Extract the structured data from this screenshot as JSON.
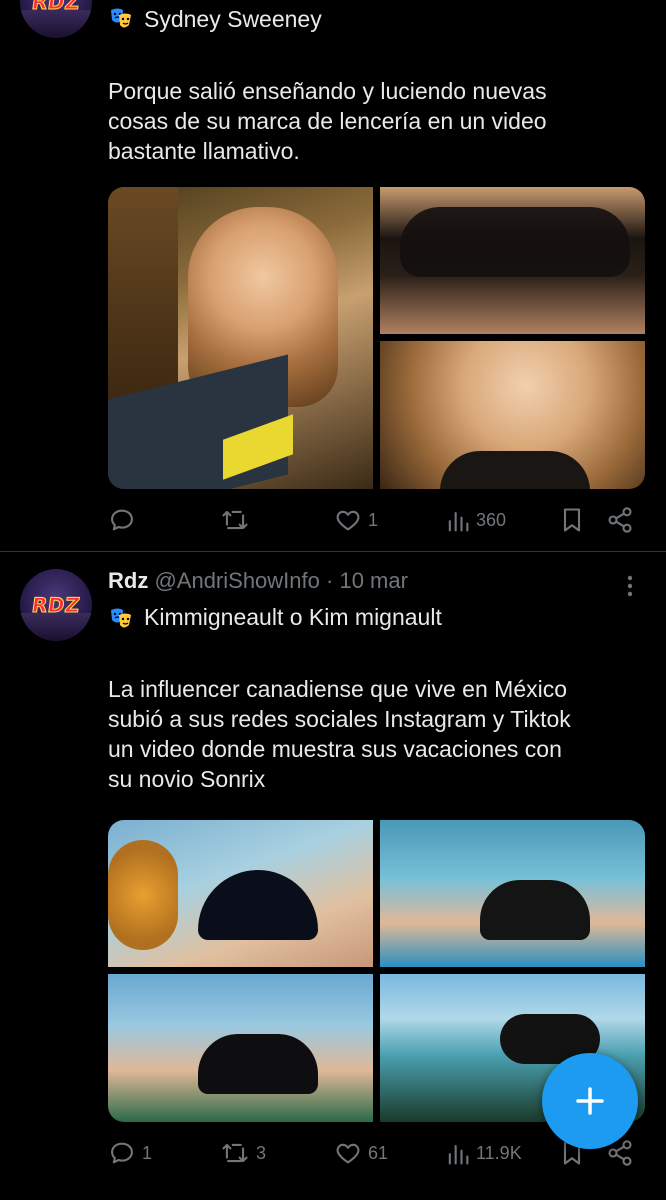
{
  "tweet1": {
    "avatar_text": "RDZ",
    "tag": "Sydney Sweeney",
    "body_lines": [
      "Porque salió enseñando y luciendo nuevas",
      "cosas de su marca de lencería en un video",
      "bastante llamativo."
    ],
    "actions": {
      "replies": "",
      "retweets": "",
      "likes": "1",
      "views": "360"
    }
  },
  "tweet2": {
    "avatar_text": "RDZ",
    "name": "Rdz",
    "handle": "@AndriShowInfo",
    "separator": "·",
    "date": "10 mar",
    "tag": "Kimmigneault o Kim mignault",
    "body_lines": [
      "La influencer canadiense que vive en México",
      "subió a sus redes sociales Instagram y Tiktok",
      "un video donde muestra sus vacaciones con",
      "su novio Sonrix"
    ],
    "actions": {
      "replies": "1",
      "retweets": "3",
      "likes": "61",
      "views": "11.9K"
    }
  },
  "colors": {
    "background": "#000000",
    "text": "#e7e9ea",
    "muted": "#71767b",
    "accent": "#1d9bf0"
  },
  "icons": [
    "theater-mask-icon",
    "reply-icon",
    "retweet-icon",
    "like-icon",
    "views-icon",
    "bookmark-icon",
    "share-icon",
    "more-icon",
    "plus-icon"
  ]
}
